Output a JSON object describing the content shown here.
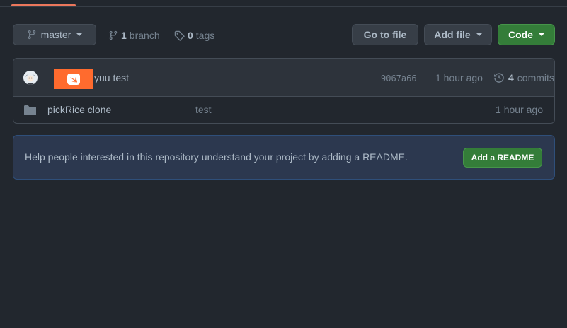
{
  "repo_nav": {
    "branch_button": {
      "label": "master",
      "icon": "git-branch-icon"
    },
    "branches": {
      "count": "1",
      "label": "branch"
    },
    "tags": {
      "count": "0",
      "label": "tags"
    },
    "go_to_file": "Go to file",
    "add_file": "Add file",
    "code": "Code"
  },
  "latest_commit": {
    "author_redacted": true,
    "message": "yuu test",
    "sha": "9067a66",
    "time": "1 hour ago",
    "commits_count": "4",
    "commits_label": "commits"
  },
  "files": [
    {
      "name": "pickRice clone",
      "commit_message": "test",
      "time": "1 hour ago",
      "icon": "folder-icon"
    }
  ],
  "readme_banner": {
    "text": "Help people interested in this repository understand your project by adding a README.",
    "button": "Add a README"
  },
  "colors": {
    "background": "#22272e",
    "primary_green": "#347d39",
    "accent_orange": "#ec775c",
    "redaction_orange": "#ff6b2e"
  }
}
